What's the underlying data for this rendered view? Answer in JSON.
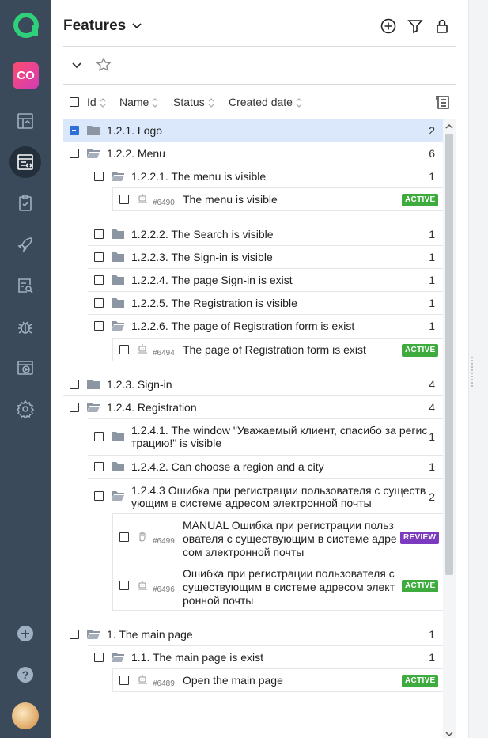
{
  "sidebar": {
    "project_initials": "CO",
    "nav": [
      "dashboard-icon",
      "test-cases-icon",
      "checklist-icon",
      "rocket-icon",
      "search-report-icon",
      "bug-icon",
      "test-run-icon",
      "settings-icon"
    ],
    "bottom": [
      "add-icon",
      "help-icon",
      "user-avatar"
    ]
  },
  "header": {
    "title": "Features"
  },
  "columns": {
    "id": "Id",
    "name": "Name",
    "status": "Status",
    "created": "Created date"
  },
  "tree": {
    "r1": {
      "label": "1.2.1. Logo",
      "count": "2"
    },
    "r2": {
      "label": "1.2.2. Menu",
      "count": "6"
    },
    "r3": {
      "label": "1.2.2.1. The menu is visible",
      "count": "1"
    },
    "c1": {
      "id": "#6490",
      "title": "The menu is visible",
      "status": "ACTIVE"
    },
    "r4": {
      "label": "1.2.2.2. The Search is visible",
      "count": "1"
    },
    "r5": {
      "label": "1.2.2.3. The Sign-in is visible",
      "count": "1"
    },
    "r6": {
      "label": "1.2.2.4. The page Sign-in is exist",
      "count": "1"
    },
    "r7": {
      "label": "1.2.2.5. The Registration is visible",
      "count": "1"
    },
    "r8": {
      "label": "1.2.2.6. The page of Registration form is exist",
      "count": "1"
    },
    "c2": {
      "id": "#6494",
      "title": "The page of Registration form is exist",
      "status": "ACTIVE"
    },
    "r9": {
      "label": "1.2.3. Sign-in",
      "count": "4"
    },
    "r10": {
      "label": "1.2.4. Registration",
      "count": "4"
    },
    "r11": {
      "line1": "1.2.4.1. The window \"Уважаемый клиент, спасибо за регис",
      "line2": "трацию!\" is visible",
      "count": "1"
    },
    "r12": {
      "label": "1.2.4.2. Can choose a region and a city",
      "count": "1"
    },
    "r13": {
      "line1": "1.2.4.3 Ошибка при регистрации пользователя с существ",
      "line2": "ующим в системе адресом электронной почты",
      "count": "2"
    },
    "c3": {
      "id": "#6499",
      "line1": "MANUAL Ошибка при регистрации польз",
      "line2": "ователя с существующим в системе адре",
      "line3": "сом электронной почты",
      "status": "REVIEW"
    },
    "c4": {
      "id": "#6496",
      "line1": "Ошибка при регистрации пользователя с",
      "line2": "существующим в системе адресом элект",
      "line3": "ронной почты",
      "status": "ACTIVE"
    },
    "r14": {
      "label": "1. The main page",
      "count": "1"
    },
    "r15": {
      "label": "1.1. The main page is exist",
      "count": "1"
    },
    "c5": {
      "id": "#6489",
      "title": "Open the main page",
      "status": "ACTIVE"
    }
  },
  "colors": {
    "sidebar": "#3a4a5a",
    "active_badge": "#3dab3d",
    "review_badge": "#7c3bbf",
    "selection": "#dbe8fb"
  }
}
